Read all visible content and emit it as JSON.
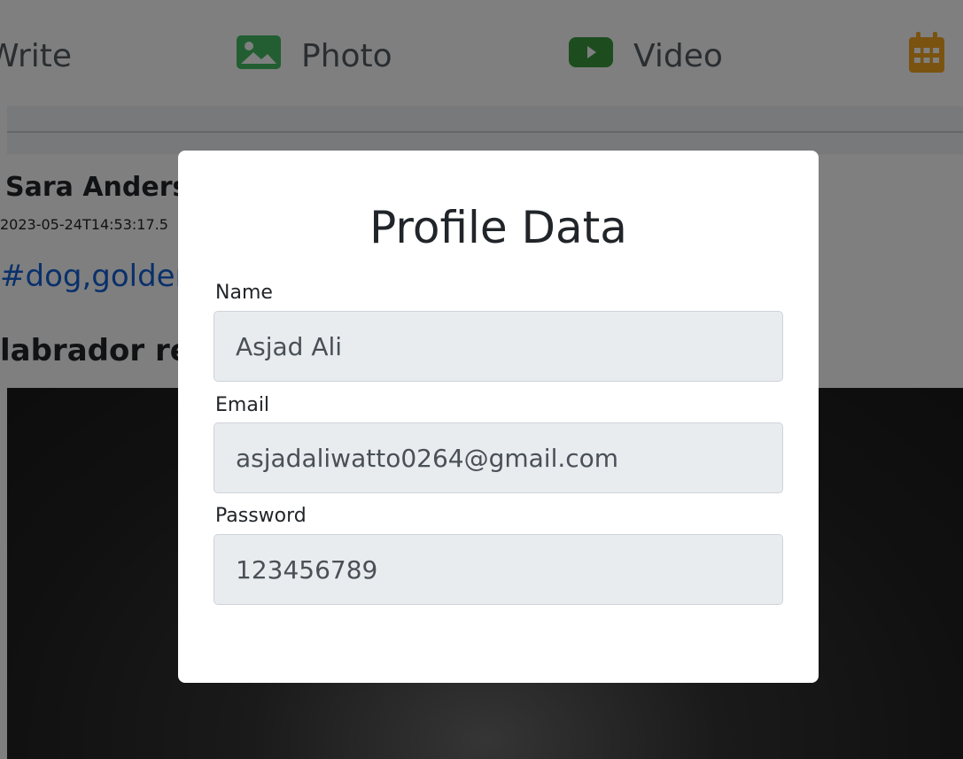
{
  "composer": {
    "write_label": "Write",
    "photo_label": "Photo",
    "video_label": "Video",
    "colors": {
      "photo_icon": "#45bd62",
      "video_icon": "#3a9a3f",
      "event_icon": "#f5a623"
    }
  },
  "post": {
    "author": "Sara Andersen",
    "timestamp": "2023-05-24T14:53:17.5",
    "tags": "#dog,golden retriever",
    "caption": "labrador retriever"
  },
  "modal": {
    "title": "Profile Data",
    "fields": {
      "name": {
        "label": "Name",
        "value": "Asjad Ali"
      },
      "email": {
        "label": "Email",
        "value": "asjadaliwatto0264@gmail.com"
      },
      "password": {
        "label": "Password",
        "value": "123456789"
      }
    }
  }
}
